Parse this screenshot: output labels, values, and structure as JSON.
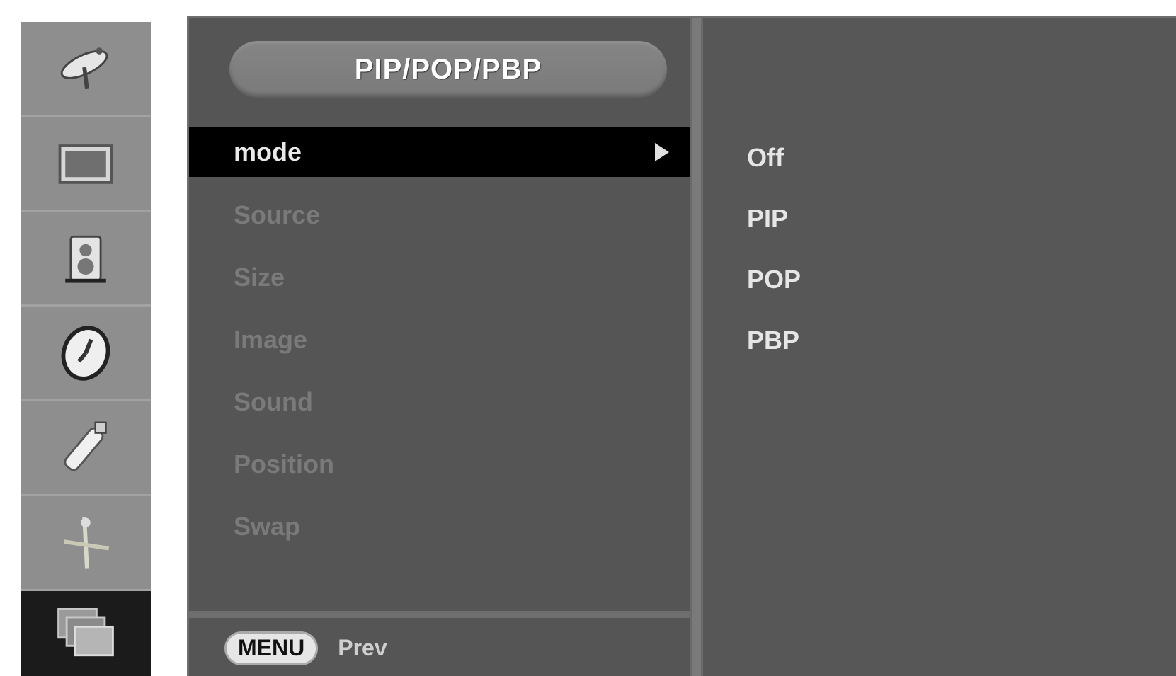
{
  "menu": {
    "title": "PIP/POP/PBP",
    "items": [
      {
        "label": "mode",
        "active": true
      },
      {
        "label": "Source",
        "active": false
      },
      {
        "label": "Size",
        "active": false
      },
      {
        "label": "Image",
        "active": false
      },
      {
        "label": "Sound",
        "active": false
      },
      {
        "label": "Position",
        "active": false
      },
      {
        "label": "Swap",
        "active": false
      }
    ]
  },
  "options": [
    "Off",
    "PIP",
    "POP",
    "PBP"
  ],
  "footer": {
    "key_label": "MENU",
    "action_label": "Prev"
  },
  "rail": {
    "icons": [
      "satellite-dish-icon",
      "screen-icon",
      "audio-speaker-icon",
      "time-clock-icon",
      "remote-key-icon",
      "tuning-icon",
      "pip-windows-icon"
    ],
    "selected_index": 6
  },
  "colors": {
    "panel": "#565656",
    "highlight": "#000000",
    "rail": "#8e8e8e",
    "text": "#e6e6e6"
  }
}
